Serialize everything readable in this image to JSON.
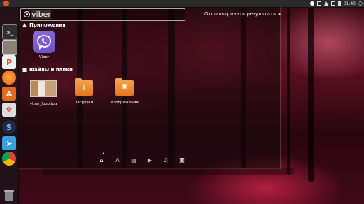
{
  "topbar": {
    "clock": "01:40"
  },
  "launcher": {
    "items": [
      {
        "icon": "terminal-icon"
      },
      {
        "icon": "files-icon"
      },
      {
        "icon": "ubuntu-one-icon"
      },
      {
        "icon": "firefox-icon"
      },
      {
        "icon": "software-center-icon"
      },
      {
        "icon": "system-settings-icon"
      },
      {
        "icon": "steam-icon"
      },
      {
        "icon": "telegram-icon"
      },
      {
        "icon": "chrome-icon"
      },
      {
        "icon": "trash-icon"
      }
    ]
  },
  "dash": {
    "search": {
      "value": "viber"
    },
    "filter_label": "Отфильтровать результаты",
    "categories": {
      "apps": {
        "title": "Приложения",
        "items": [
          {
            "label": "Viber"
          }
        ]
      },
      "files": {
        "title": "Файлы и папки",
        "items": [
          {
            "label": "viber_logo.jpg"
          },
          {
            "label": "Загрузки"
          },
          {
            "label": "Изображения"
          }
        ]
      }
    },
    "lenses": [
      "home-icon",
      "applications-icon",
      "files-icon",
      "video-icon",
      "music-icon",
      "photos-icon"
    ]
  },
  "colors": {
    "accent": "#e95420",
    "viber": "#7b5ccf",
    "folder": "#f08c2e"
  }
}
